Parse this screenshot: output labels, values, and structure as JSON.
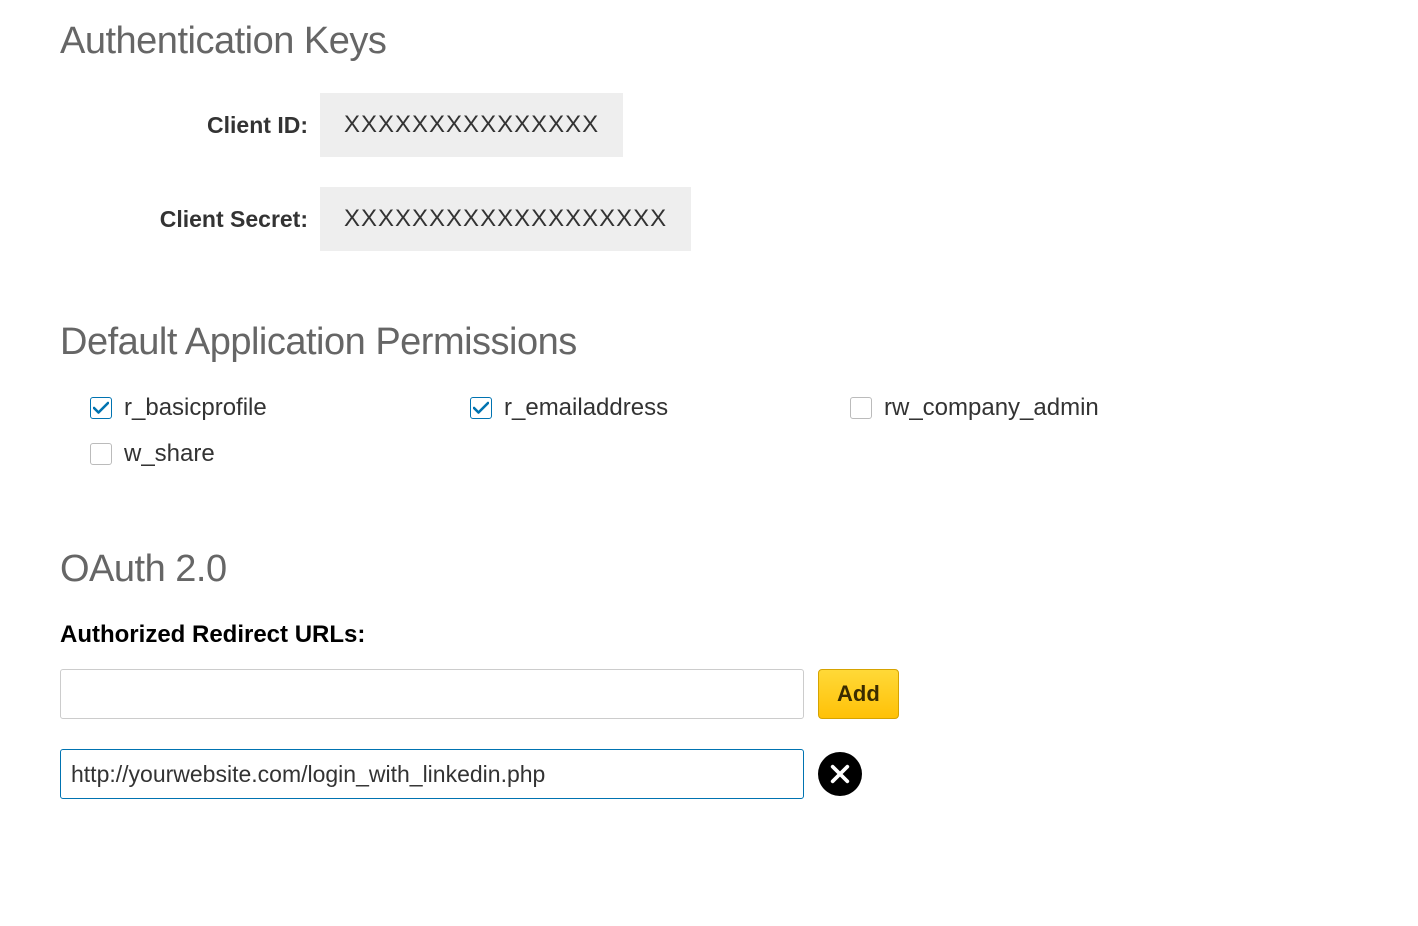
{
  "auth": {
    "heading": "Authentication Keys",
    "client_id_label": "Client ID:",
    "client_id_value": "XXXXXXXXXXXXXXX",
    "client_secret_label": "Client Secret:",
    "client_secret_value": "XXXXXXXXXXXXXXXXXXX"
  },
  "permissions": {
    "heading": "Default Application Permissions",
    "items": [
      {
        "label": "r_basicprofile",
        "checked": true
      },
      {
        "label": "r_emailaddress",
        "checked": true
      },
      {
        "label": "rw_company_admin",
        "checked": false
      },
      {
        "label": "w_share",
        "checked": false
      }
    ]
  },
  "oauth": {
    "heading": "OAuth 2.0",
    "redirect_label": "Authorized Redirect URLs:",
    "new_url_value": "",
    "add_label": "Add",
    "urls": [
      "http://yourwebsite.com/login_with_linkedin.php"
    ]
  }
}
